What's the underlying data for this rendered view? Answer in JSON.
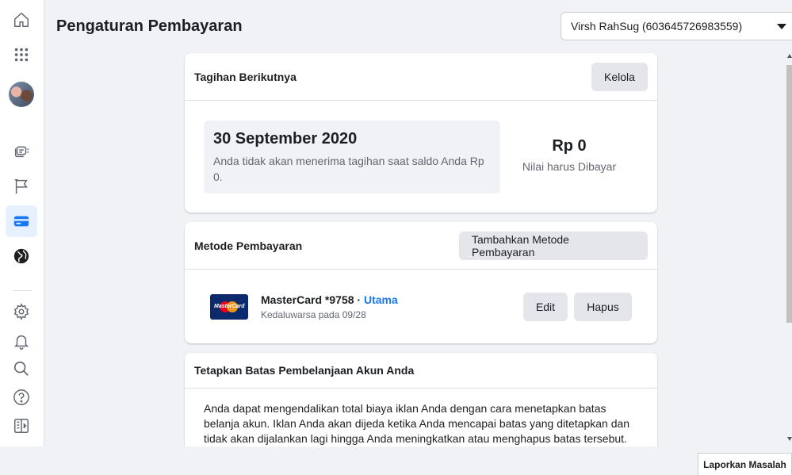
{
  "header": {
    "title": "Pengaturan Pembayaran",
    "account_selector": "Virsh RahSug (603645726983559)"
  },
  "sidebar": {
    "icons": [
      "home-icon",
      "apps-grid-icon",
      "avatar",
      "ads-manager-icon",
      "pages-flag-icon",
      "billing-card-icon",
      "globe-icon",
      "settings-icon",
      "notifications-icon",
      "search-icon",
      "help-icon",
      "collapse-panel-icon"
    ]
  },
  "next_bill": {
    "title": "Tagihan Berikutnya",
    "manage_label": "Kelola",
    "date": "30 September 2020",
    "note": "Anda tidak akan menerima tagihan saat saldo Anda Rp 0.",
    "amount": "Rp 0",
    "amount_label": "Nilai harus Dibayar"
  },
  "payment_methods": {
    "title": "Metode Pembayaran",
    "add_label": "Tambahkan Metode Pembayaran",
    "card": {
      "brand_logo_text": "MasterCard",
      "name": "MasterCard *9758",
      "separator": " · ",
      "primary_label": "Utama",
      "expiry": "Kedaluwarsa pada 09/28"
    },
    "edit_label": "Edit",
    "delete_label": "Hapus"
  },
  "spending_limit": {
    "title": "Tetapkan Batas Pembelanjaan Akun Anda",
    "body": "Anda dapat mengendalikan total biaya iklan Anda dengan cara menetapkan batas belanja akun. Iklan Anda akan dijeda ketika Anda mencapai batas yang ditetapkan dan tidak akan dijalankan lagi hingga Anda meningkatkan atau menghapus batas tersebut."
  },
  "footer": {
    "report_label": "Laporkan Masalah"
  },
  "colors": {
    "accent": "#1877f2",
    "background": "#f0f2f5",
    "button": "#e4e6eb"
  }
}
